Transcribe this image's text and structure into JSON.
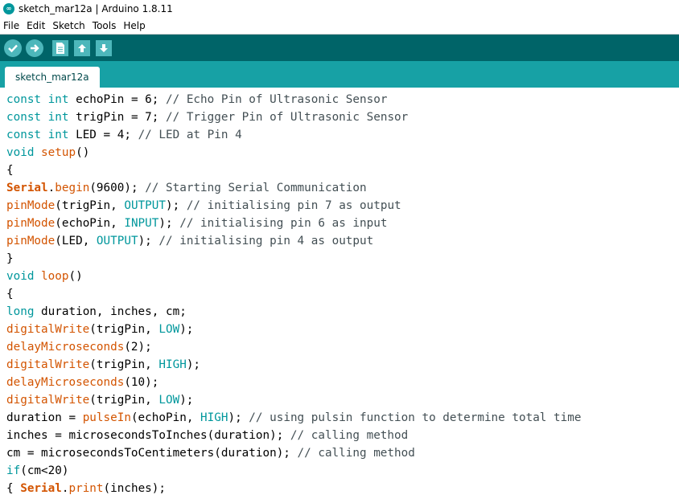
{
  "window": {
    "title": "sketch_mar12a | Arduino 1.8.11",
    "icon": "arduino-icon"
  },
  "menu": [
    "File",
    "Edit",
    "Sketch",
    "Tools",
    "Help"
  ],
  "toolbar": {
    "buttons": [
      "verify-icon",
      "upload-icon",
      "new-icon",
      "open-icon",
      "save-icon"
    ]
  },
  "tabs": [
    {
      "label": "sketch_mar12a"
    }
  ],
  "colors": {
    "toolbar_bg": "#006468",
    "tabbar_bg": "#17a1a5",
    "keyword": "#00979c",
    "function": "#d35400",
    "comment": "#434f54"
  },
  "code_lines": [
    [
      {
        "t": "const",
        "c": "kw"
      },
      {
        "t": " "
      },
      {
        "t": "int",
        "c": "kw"
      },
      {
        "t": " echoPin = 6; "
      },
      {
        "t": "// Echo Pin of Ultrasonic Sensor",
        "c": "cm"
      }
    ],
    [
      {
        "t": "const",
        "c": "kw"
      },
      {
        "t": " "
      },
      {
        "t": "int",
        "c": "kw"
      },
      {
        "t": " trigPin = 7; "
      },
      {
        "t": "// Trigger Pin of Ultrasonic Sensor",
        "c": "cm"
      }
    ],
    [
      {
        "t": "const",
        "c": "kw"
      },
      {
        "t": " "
      },
      {
        "t": "int",
        "c": "kw"
      },
      {
        "t": " LED = 4; "
      },
      {
        "t": "// LED at Pin 4",
        "c": "cm"
      }
    ],
    [
      {
        "t": "void",
        "c": "kw"
      },
      {
        "t": " "
      },
      {
        "t": "setup",
        "c": "fn"
      },
      {
        "t": "()"
      }
    ],
    [
      {
        "t": "{"
      }
    ],
    [
      {
        "t": "Serial",
        "c": "cls"
      },
      {
        "t": "."
      },
      {
        "t": "begin",
        "c": "fn"
      },
      {
        "t": "(9600); "
      },
      {
        "t": "// Starting Serial Communication",
        "c": "cm"
      }
    ],
    [
      {
        "t": "pinMode",
        "c": "fn"
      },
      {
        "t": "(trigPin, "
      },
      {
        "t": "OUTPUT",
        "c": "const"
      },
      {
        "t": "); "
      },
      {
        "t": "// initialising pin 7 as output",
        "c": "cm"
      }
    ],
    [
      {
        "t": "pinMode",
        "c": "fn"
      },
      {
        "t": "(echoPin, "
      },
      {
        "t": "INPUT",
        "c": "const"
      },
      {
        "t": "); "
      },
      {
        "t": "// initialising pin 6 as input",
        "c": "cm"
      }
    ],
    [
      {
        "t": "pinMode",
        "c": "fn"
      },
      {
        "t": "(LED, "
      },
      {
        "t": "OUTPUT",
        "c": "const"
      },
      {
        "t": "); "
      },
      {
        "t": "// initialising pin 4 as output",
        "c": "cm"
      }
    ],
    [
      {
        "t": "}"
      }
    ],
    [
      {
        "t": "void",
        "c": "kw"
      },
      {
        "t": " "
      },
      {
        "t": "loop",
        "c": "fn"
      },
      {
        "t": "()"
      }
    ],
    [
      {
        "t": "{"
      }
    ],
    [
      {
        "t": "long",
        "c": "kw"
      },
      {
        "t": " duration, inches, cm;"
      }
    ],
    [
      {
        "t": "digitalWrite",
        "c": "fn"
      },
      {
        "t": "(trigPin, "
      },
      {
        "t": "LOW",
        "c": "const"
      },
      {
        "t": ");"
      }
    ],
    [
      {
        "t": "delayMicroseconds",
        "c": "fn"
      },
      {
        "t": "(2);"
      }
    ],
    [
      {
        "t": "digitalWrite",
        "c": "fn"
      },
      {
        "t": "(trigPin, "
      },
      {
        "t": "HIGH",
        "c": "const"
      },
      {
        "t": ");"
      }
    ],
    [
      {
        "t": "delayMicroseconds",
        "c": "fn"
      },
      {
        "t": "(10);"
      }
    ],
    [
      {
        "t": "digitalWrite",
        "c": "fn"
      },
      {
        "t": "(trigPin, "
      },
      {
        "t": "LOW",
        "c": "const"
      },
      {
        "t": ");"
      }
    ],
    [
      {
        "t": "duration = "
      },
      {
        "t": "pulseIn",
        "c": "fn"
      },
      {
        "t": "(echoPin, "
      },
      {
        "t": "HIGH",
        "c": "const"
      },
      {
        "t": "); "
      },
      {
        "t": "// using pulsin function to determine total time",
        "c": "cm"
      }
    ],
    [
      {
        "t": "inches = microsecondsToInches(duration); "
      },
      {
        "t": "// calling method",
        "c": "cm"
      }
    ],
    [
      {
        "t": "cm = microsecondsToCentimeters(duration); "
      },
      {
        "t": "// calling method",
        "c": "cm"
      }
    ],
    [
      {
        "t": "if",
        "c": "kw"
      },
      {
        "t": "(cm<20)"
      }
    ],
    [
      {
        "t": "{ "
      },
      {
        "t": "Serial",
        "c": "cls"
      },
      {
        "t": "."
      },
      {
        "t": "print",
        "c": "fn"
      },
      {
        "t": "(inches);"
      }
    ]
  ]
}
